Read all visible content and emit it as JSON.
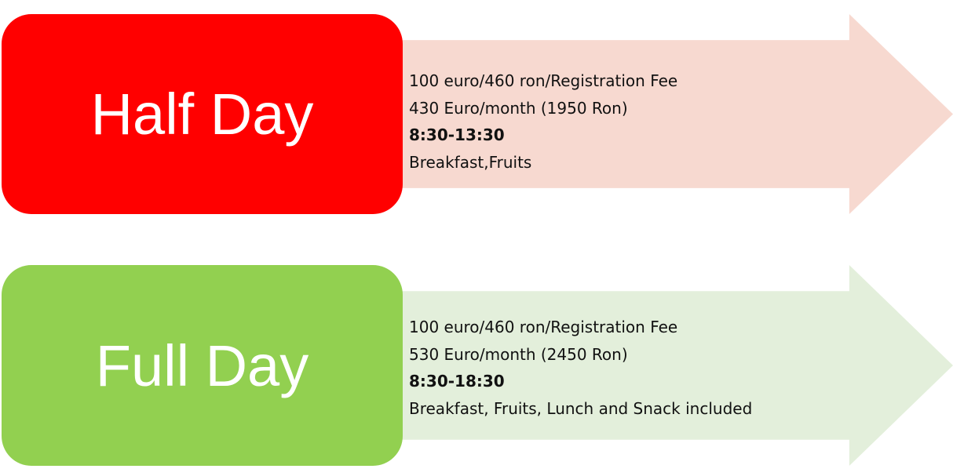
{
  "colors": {
    "half_day_box": "#ff0000",
    "half_day_arrow": "#f7d9d0",
    "full_day_box": "#92d050",
    "full_day_arrow": "#e3efdb",
    "title_text": "#ffffff",
    "detail_text": "#111111"
  },
  "plans": [
    {
      "title": "Half Day",
      "registration": "100 euro/460 ron/Registration Fee",
      "price": "430 Euro/month (1950 Ron)",
      "hours": "8:30-13:30",
      "meals": "Breakfast,Fruits"
    },
    {
      "title": "Full Day",
      "registration": "100 euro/460 ron/Registration Fee",
      "price": "530 Euro/month (2450 Ron)",
      "hours": "8:30-18:30",
      "meals": "Breakfast, Fruits, Lunch and Snack included"
    }
  ]
}
